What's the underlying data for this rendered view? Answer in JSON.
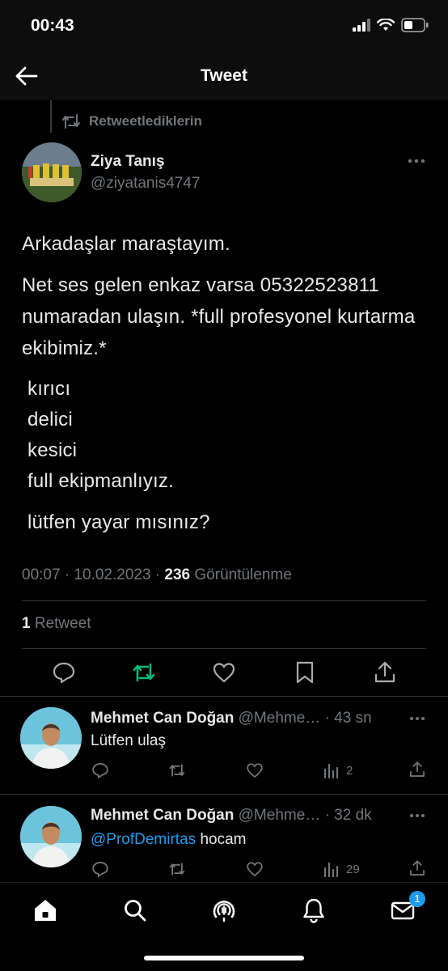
{
  "status_bar": {
    "time": "00:43"
  },
  "header": {
    "title": "Tweet"
  },
  "retweet_context": {
    "label": "Retweetlediklerin"
  },
  "tweet": {
    "author_name": "Ziya Tanış",
    "author_handle": "@ziyatanis4747",
    "paragraph1": "Arkadaşlar maraştayım.",
    "paragraph2": "Net ses gelen enkaz varsa 05322523811 numaradan ulaşın. *full profesyonel kurtarma ekibimiz.*",
    "list": [
      "kırıcı",
      "delici",
      "kesici",
      "full ekipmanlıyız."
    ],
    "paragraph4": "lütfen yayar mısınız?",
    "timestamp": "00:07 · 10.02.2023 ·",
    "views_count": "236",
    "views_label": "Görüntülenme",
    "retweet_count": "1",
    "retweet_label": "Retweet"
  },
  "replies": [
    {
      "name": "Mehmet Can Doğan",
      "handle": "@Mehme…",
      "time": "· 43 sn",
      "text": "Lütfen ulaş",
      "mention": "",
      "views": "2"
    },
    {
      "name": "Mehmet Can Doğan",
      "handle": "@Mehme…",
      "time": "· 32 dk",
      "text": "hocam",
      "mention": "@ProfDemirtas",
      "views": "29"
    }
  ],
  "bottom_nav": {
    "messages_badge": "1"
  },
  "colors": {
    "accent": "#1d9bf0",
    "retweet_green": "#00ba7c",
    "muted": "#71767b",
    "text": "#e7e9ea"
  }
}
